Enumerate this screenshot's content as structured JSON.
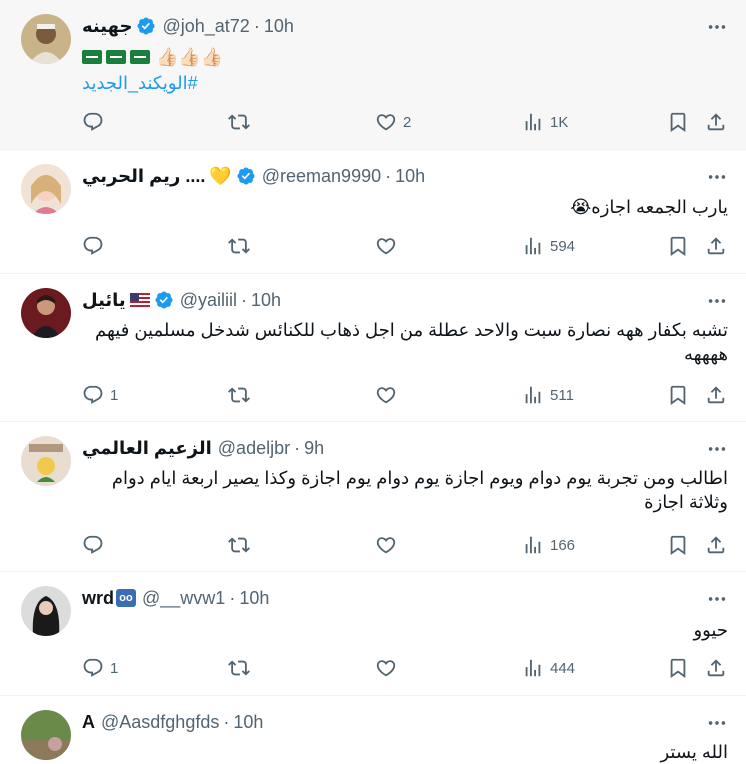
{
  "tweets": [
    {
      "name": "جهينه",
      "handle": "@joh_at72",
      "time": "10h",
      "line1_emoji": "👍🏻👍🏻👍🏻",
      "hashtag": "#الويكند_الجديد",
      "stats": {
        "reply": "",
        "retweet": "",
        "like": "2",
        "views": "1K"
      }
    },
    {
      "name": "ريم الحربي ....",
      "heart": "💛",
      "handle": "@reeman9990",
      "time": "10h",
      "text": "يارب الجمعه اجازه😭",
      "stats": {
        "reply": "",
        "retweet": "",
        "like": "",
        "views": "594"
      }
    },
    {
      "name": "يائيل",
      "handle": "@yailiil",
      "time": "10h",
      "text": "تشبه بكفار ههه نصارة سبت والاحد عطلة من اجل ذهاب للكنائس شدخل مسلمين فيهم ههههه",
      "stats": {
        "reply": "1",
        "retweet": "",
        "like": "",
        "views": "511"
      }
    },
    {
      "name": "الزعيم العالمي",
      "handle": "@adeljbr",
      "time": "9h",
      "text": "اطالب ومن تجربة يوم دوام ويوم اجازة يوم دوام يوم اجازة وكذا يصير اربعة ايام دوام وثلاثة اجازة",
      "stats": {
        "reply": "",
        "retweet": "",
        "like": "",
        "views": "166"
      }
    },
    {
      "name": "wrd",
      "handle": "@__wvw1",
      "time": "10h",
      "text": "حيوو",
      "stats": {
        "reply": "1",
        "retweet": "",
        "like": "",
        "views": "444"
      }
    },
    {
      "name": "A",
      "handle": "@Aasdfghgfds",
      "time": "10h",
      "text": "الله يستر"
    }
  ],
  "icons": {
    "reply": "reply-icon",
    "retweet": "retweet-icon",
    "like": "heart-icon",
    "views": "views-icon",
    "bookmark": "bookmark-icon",
    "share": "share-icon",
    "more": "more-icon",
    "verified": "verified-badge-icon"
  },
  "colors": {
    "verified": "#1d9bf0",
    "hashtag": "#1d9bf0",
    "muted": "#536471"
  }
}
